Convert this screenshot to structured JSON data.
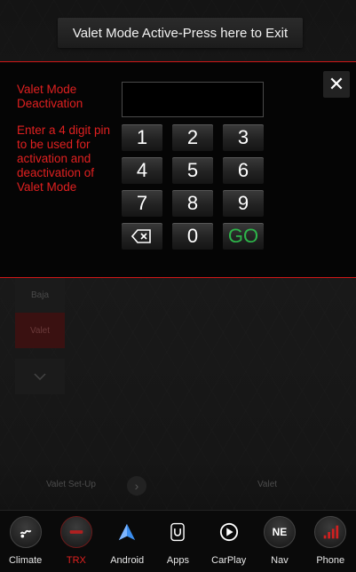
{
  "banner": {
    "text": "Valet Mode Active-Press here to Exit"
  },
  "modal": {
    "title": "Valet Mode Deactivation",
    "description": "Enter a 4 digit pin to be used for activation and deactivation of Valet Mode",
    "close_label": "✕",
    "keys": [
      "1",
      "2",
      "3",
      "4",
      "5",
      "6",
      "7",
      "8",
      "9",
      "0",
      "GO"
    ]
  },
  "underlying": {
    "side_items": [
      "Baja",
      "Valet"
    ],
    "valet_setup_label": "Valet Set-Up",
    "valet_label": "Valet"
  },
  "nav": {
    "items": [
      {
        "label": "Climate",
        "icon": "climate-icon"
      },
      {
        "label": "TRX",
        "icon": "trx-icon"
      },
      {
        "label": "Android",
        "icon": "android-auto-icon"
      },
      {
        "label": "Apps",
        "icon": "apps-icon"
      },
      {
        "label": "CarPlay",
        "icon": "carplay-icon"
      },
      {
        "label": "Nav",
        "icon": "compass-icon",
        "badge": "NE"
      },
      {
        "label": "Phone",
        "icon": "phone-signal-icon"
      }
    ]
  },
  "colors": {
    "accent_red": "#e02020",
    "go_green": "#2db54a"
  }
}
